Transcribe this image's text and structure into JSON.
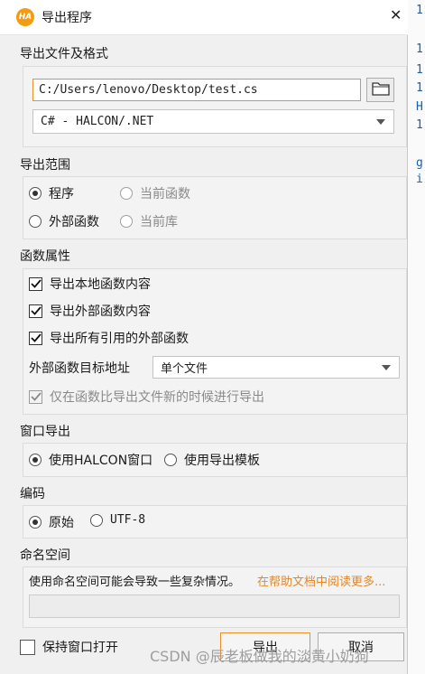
{
  "background_code": [
    "1",
    "1",
    "1",
    "1",
    "H",
    "1",
    "g",
    "i"
  ],
  "window": {
    "title": "导出程序",
    "logo_text": "HA"
  },
  "export_file": {
    "section_label": "导出文件及格式",
    "path_value": "C:/Users/lenovo/Desktop/test.cs",
    "format_selected": "C# - HALCON/.NET"
  },
  "export_range": {
    "section_label": "导出范围",
    "options": [
      {
        "label": "程序",
        "selected": true,
        "enabled": true
      },
      {
        "label": "当前函数",
        "selected": false,
        "enabled": false
      },
      {
        "label": "外部函数",
        "selected": false,
        "enabled": true
      },
      {
        "label": "当前库",
        "selected": false,
        "enabled": false
      }
    ]
  },
  "function_props": {
    "section_label": "函数属性",
    "checkboxes": [
      {
        "label": "导出本地函数内容",
        "checked": true
      },
      {
        "label": "导出外部函数内容",
        "checked": true
      },
      {
        "label": "导出所有引用的外部函数",
        "checked": true
      }
    ],
    "target_label": "外部函数目标地址",
    "target_selected": "单个文件",
    "newer_only_label": "仅在函数比导出文件新的时候进行导出",
    "newer_only_checked": true
  },
  "window_export": {
    "section_label": "窗口导出",
    "options": [
      {
        "label": "使用HALCON窗口",
        "selected": true
      },
      {
        "label": "使用导出模板",
        "selected": false
      }
    ]
  },
  "encoding": {
    "section_label": "编码",
    "options": [
      {
        "label": "原始",
        "selected": true
      },
      {
        "label": "UTF-8",
        "selected": false
      }
    ]
  },
  "namespace": {
    "section_label": "命名空间",
    "hint": "使用命名空间可能会导致一些复杂情况。",
    "help_link": "在帮助文档中阅读更多...",
    "value": ""
  },
  "footer": {
    "keep_open_label": "保持窗口打开",
    "keep_open_checked": false,
    "export_button": "导出",
    "cancel_button": "取消"
  },
  "watermark": "CSDN @辰老板做我的淡黄小奶狗",
  "colors": {
    "accent": "#e8912d",
    "logo": "#f39c12",
    "link": "#e0892c",
    "dialog_bg": "#f0f0f0"
  }
}
